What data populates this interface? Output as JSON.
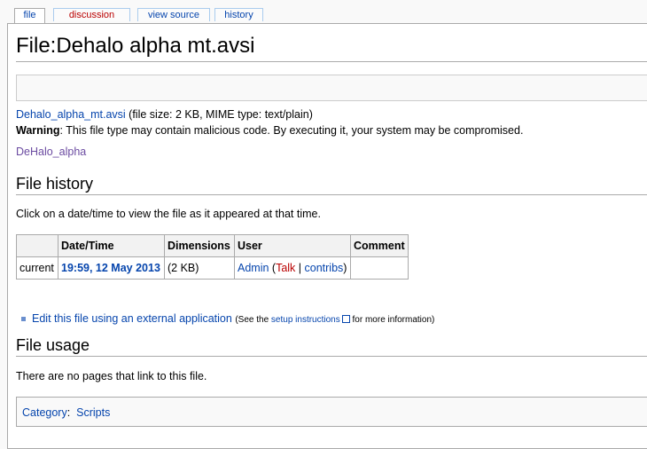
{
  "tabs": [
    {
      "label": "file",
      "selected": true
    },
    {
      "label": "discussion",
      "selected": false,
      "missing_page": true
    },
    {
      "label": "view source",
      "selected": false
    },
    {
      "label": "history",
      "selected": false
    }
  ],
  "page": {
    "title": "File:Dehalo alpha mt.avsi"
  },
  "file_info": {
    "filename_link": "Dehalo_alpha_mt.avsi",
    "details": " (file size: 2 KB, MIME type: text/plain)",
    "warning_label": "Warning",
    "warning_text": ": This file type may contain malicious code. By executing it, your system may be compromised.",
    "related_link": "DeHalo_alpha"
  },
  "file_history": {
    "heading": "File history",
    "intro": "Click on a date/time to view the file as it appeared at that time.",
    "columns": [
      "",
      "Date/Time",
      "Dimensions",
      "User",
      "Comment"
    ],
    "rows": [
      {
        "version": "current",
        "datetime": "19:59, 12 May 2013",
        "dimensions": "(2 KB)",
        "user": "Admin",
        "talk": "Talk",
        "contribs": "contribs",
        "comment": ""
      }
    ]
  },
  "external_edit": {
    "link": "Edit this file using an external application",
    "note_prefix": "(See the ",
    "note_link": "setup instructions",
    "note_suffix": " for more information)"
  },
  "file_usage": {
    "heading": "File usage",
    "text": "There are no pages that link to this file."
  },
  "categories": {
    "label": "Category",
    "items": [
      "Scripts"
    ]
  }
}
